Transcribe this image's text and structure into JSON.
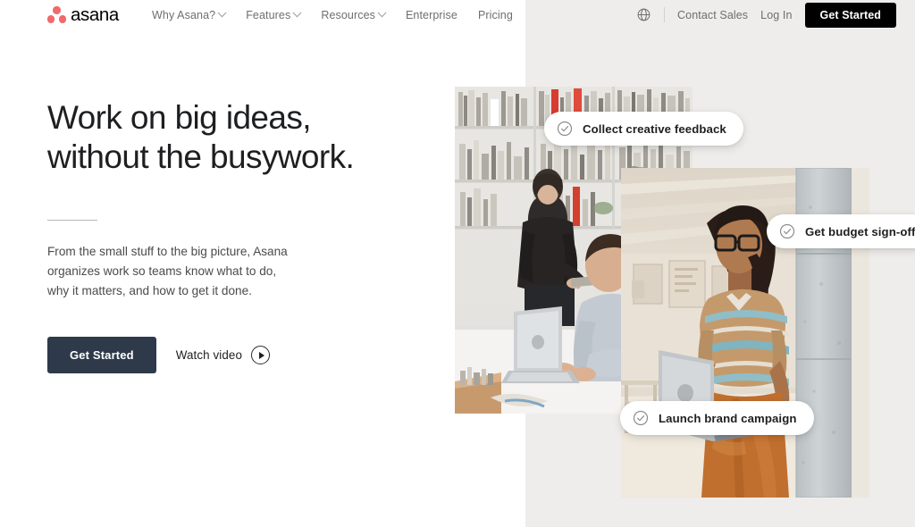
{
  "brand": {
    "name": "asana",
    "logo_icon": "asana-dots-logo",
    "dot_color": "#f06a6a"
  },
  "header": {
    "nav_items": [
      {
        "label": "Why Asana?",
        "has_dropdown": true
      },
      {
        "label": "Features",
        "has_dropdown": true
      },
      {
        "label": "Resources",
        "has_dropdown": true
      },
      {
        "label": "Enterprise",
        "has_dropdown": false
      },
      {
        "label": "Pricing",
        "has_dropdown": false
      }
    ],
    "language_icon": "globe-icon",
    "contact_sales": "Contact Sales",
    "log_in": "Log In",
    "get_started": "Get Started",
    "get_started_bg": "#000000"
  },
  "hero": {
    "headline_line1": "Work on big ideas,",
    "headline_line2": "without the busywork.",
    "body_line1": "From the small stuff to the big picture, Asana",
    "body_line2": "organizes work so teams know what to do,",
    "body_line3": "why it matters, and how to get it done.",
    "primary_cta": "Get Started",
    "primary_cta_bg": "#2e3a4a",
    "secondary_cta": "Watch video",
    "play_icon": "play-circle-icon"
  },
  "pills": [
    {
      "label": "Collect creative feedback",
      "icon": "check-circle-icon"
    },
    {
      "label": "Get budget sign-off",
      "icon": "check-circle-icon"
    },
    {
      "label": "Launch brand campaign",
      "icon": "check-circle-icon"
    }
  ],
  "photos": [
    {
      "name": "office-collaboration-photo",
      "alt": "Woman with tablet standing beside man typing on laptop in a studio with bookshelves"
    },
    {
      "name": "woman-with-laptop-photo",
      "alt": "Woman with glasses holding a laptop leaning against a concrete pillar"
    }
  ],
  "background": {
    "left_color": "#ffffff",
    "right_color": "#efedeb"
  }
}
